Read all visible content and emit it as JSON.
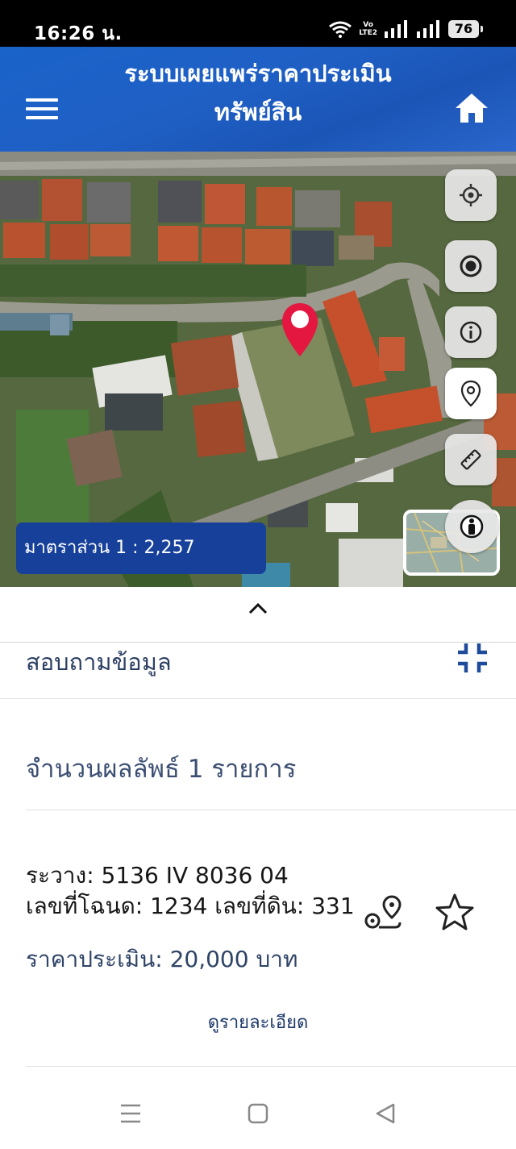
{
  "status_bar": {
    "time": "16:26 น.",
    "volte_top": "Vo",
    "volte_bottom": "LTE2",
    "battery": "76"
  },
  "header": {
    "title_line1": "ระบบเผยแพร่ราคาประเมิน",
    "title_line2": "ทรัพย์สิน",
    "menu_icon": "hamburger-menu-icon",
    "home_icon": "home-icon"
  },
  "map": {
    "scale_label": "มาตราส่วน 1 : 2,257",
    "marker_icon": "location-pin-icon",
    "tool_buttons": [
      {
        "name": "gps-locate-icon"
      },
      {
        "name": "target-icon"
      },
      {
        "name": "info-icon"
      },
      {
        "name": "map-pin-icon",
        "active": true
      },
      {
        "name": "ruler-icon"
      },
      {
        "name": "identify-icon"
      }
    ]
  },
  "panel": {
    "collapse_icon": "chevron-up-icon",
    "inquiry_label": "สอบถามข้อมูล",
    "fullscreen_icon": "collapse-fullscreen-icon",
    "results_count": "จำนวนผลลัพธ์ 1 รายการ",
    "result": {
      "line1": "ระวาง: 5136 IV 8036 04",
      "line2": "เลขที่โฉนด: 1234 เลขที่ดิน: 331",
      "price": "ราคาประเมิน: 20,000 บาท",
      "details_link": "ดูรายละเอียด",
      "route_icon": "route-icon",
      "favorite_icon": "star-icon"
    }
  },
  "nav_bar": {
    "recents_icon": "recent-apps-icon",
    "home_icon": "home-button-icon",
    "back_icon": "back-icon"
  },
  "colors": {
    "header_blue": "#1f5fc4",
    "scale_bg": "#16409a",
    "marker": "#e3173f",
    "text_blue": "#2f4467"
  }
}
